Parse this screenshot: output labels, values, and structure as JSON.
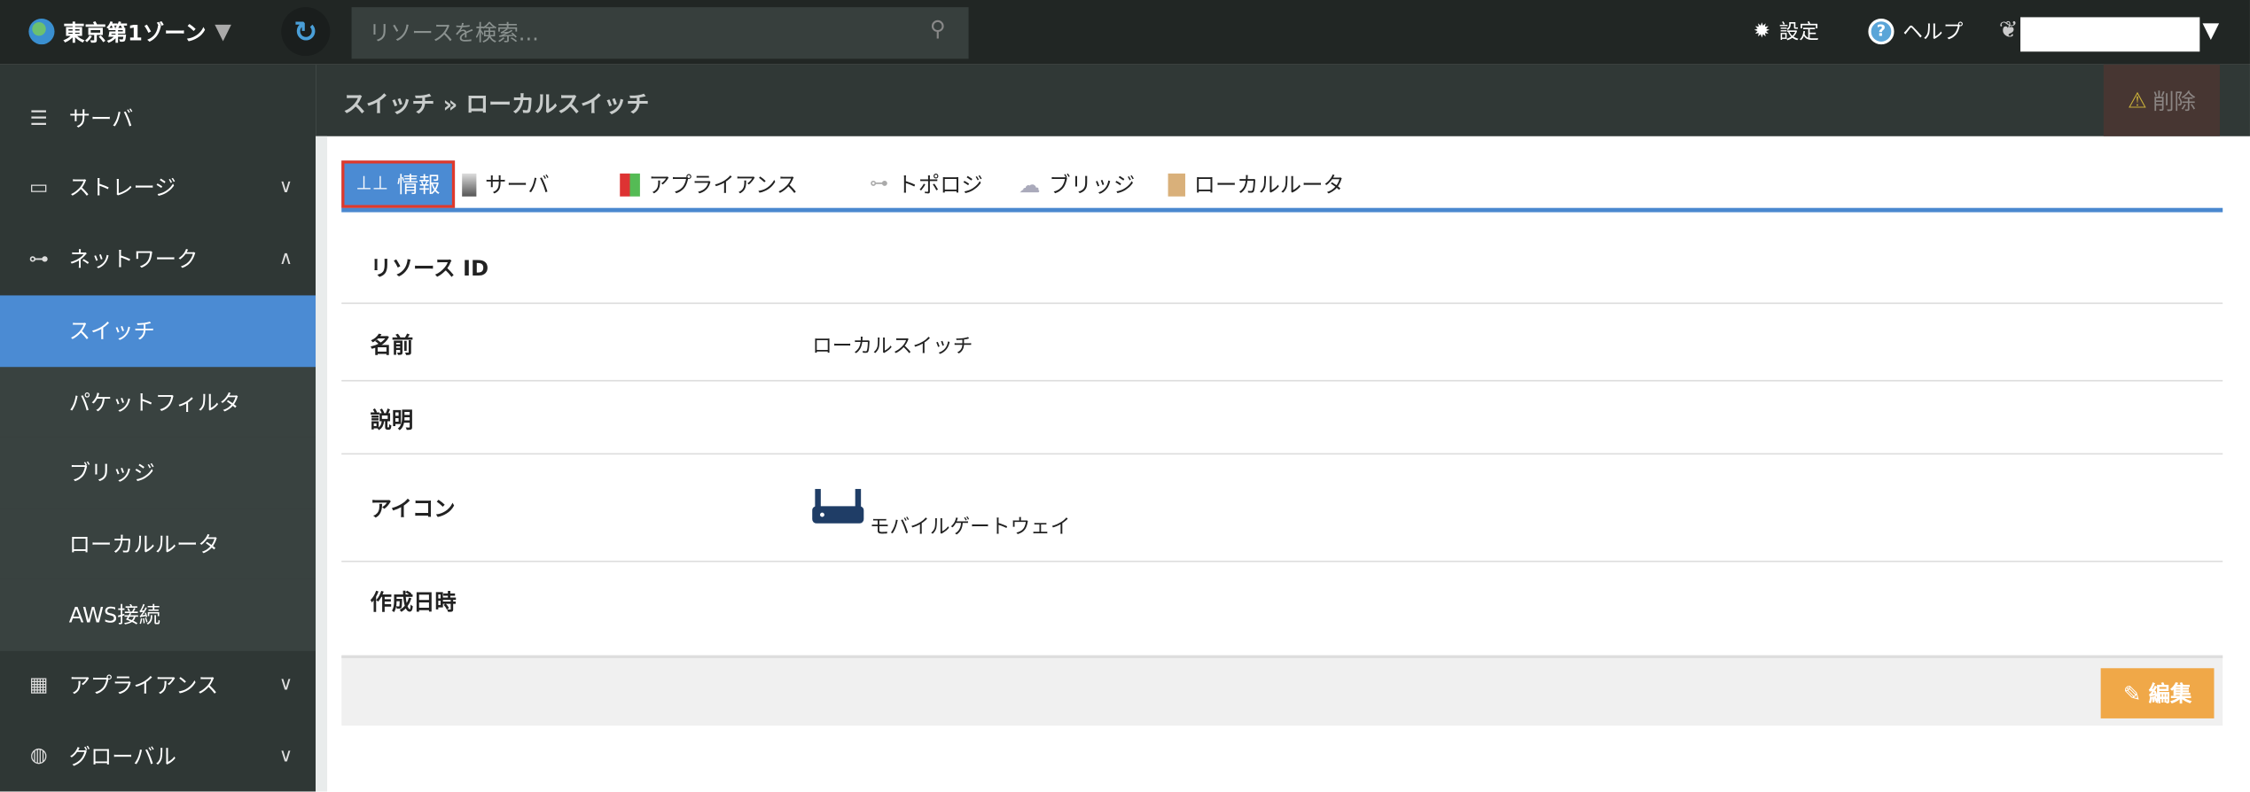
{
  "topbar": {
    "zone": "東京第1ゾーン",
    "search_placeholder": "リソースを検索...",
    "settings": "設定",
    "help": "ヘルプ"
  },
  "sidebar": {
    "items": [
      {
        "label": "サーバ"
      },
      {
        "label": "ストレージ"
      },
      {
        "label": "ネットワーク"
      },
      {
        "label": "スイッチ"
      },
      {
        "label": "パケットフィルタ"
      },
      {
        "label": "ブリッジ"
      },
      {
        "label": "ローカルルータ"
      },
      {
        "label": "AWS接続"
      },
      {
        "label": "アプライアンス"
      },
      {
        "label": "グローバル"
      }
    ]
  },
  "header": {
    "breadcrumb": "スイッチ » ローカルスイッチ",
    "delete": "削除"
  },
  "tabs": [
    {
      "label": "情報"
    },
    {
      "label": "サーバ"
    },
    {
      "label": "アプライアンス"
    },
    {
      "label": "トポロジ"
    },
    {
      "label": "ブリッジ"
    },
    {
      "label": "ローカルルータ"
    }
  ],
  "details": {
    "resource_id_label": "リソース ID",
    "resource_id": "",
    "name_label": "名前",
    "name": "ローカルスイッチ",
    "desc_label": "説明",
    "desc": "",
    "icon_label": "アイコン",
    "icon_name": "モバイルゲートウェイ",
    "created_label": "作成日時",
    "created": ""
  },
  "footer": {
    "edit": "編集"
  },
  "colors": {
    "accent": "#4b8bd3",
    "edit": "#f0a848",
    "topbar": "#212624"
  }
}
